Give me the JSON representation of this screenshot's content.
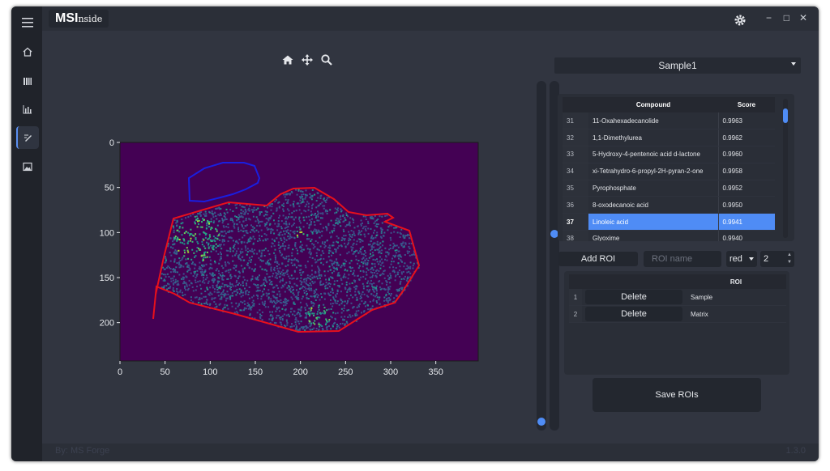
{
  "app": {
    "logo_main": "MSI",
    "logo_sub": "nside",
    "footer_left": "By: MS Forge",
    "footer_right": "1.3.0"
  },
  "window_controls": [
    "−",
    "□",
    "✕"
  ],
  "sidebar": {
    "items": [
      {
        "icon": "menu-icon"
      },
      {
        "icon": "home-icon"
      },
      {
        "icon": "library-icon"
      },
      {
        "icon": "bar-chart-icon"
      },
      {
        "icon": "draw-icon",
        "active": true
      },
      {
        "icon": "image-icon"
      }
    ]
  },
  "plot": {
    "toolbar": [
      "home-icon",
      "pan-icon",
      "zoom-icon"
    ],
    "x_ticks": [
      "0",
      "50",
      "100",
      "150",
      "200",
      "250",
      "300",
      "350"
    ],
    "y_ticks": [
      "0",
      "50",
      "100",
      "150",
      "200"
    ],
    "colormap": "viridis",
    "background_color": "#440154",
    "roi_colors": {
      "sample": "#e8101c",
      "matrix": "#1a1ee0"
    }
  },
  "sliders": {
    "left_level": 0.0,
    "right_level": 0.58
  },
  "sample_select": {
    "value": "Sample1"
  },
  "compound_table": {
    "headers": [
      "",
      "Compound",
      "Score"
    ],
    "rows": [
      {
        "index": "31",
        "compound": "11-Oxahexadecanolide",
        "score": "0.9963"
      },
      {
        "index": "32",
        "compound": "1,1-Dimethylurea",
        "score": "0.9962"
      },
      {
        "index": "33",
        "compound": "5-Hydroxy-4-pentenoic acid d-lactone",
        "score": "0.9960"
      },
      {
        "index": "34",
        "compound": "xi-Tetrahydro-6-propyl-2H-pyran-2-one",
        "score": "0.9958"
      },
      {
        "index": "35",
        "compound": "Pyrophosphate",
        "score": "0.9952"
      },
      {
        "index": "36",
        "compound": "8-oxodecanoic acid",
        "score": "0.9950"
      },
      {
        "index": "37",
        "compound": "Linoleic acid",
        "score": "0.9941",
        "selected": true
      },
      {
        "index": "38",
        "compound": "Glyoxime",
        "score": "0.9940"
      }
    ]
  },
  "roi_controls": {
    "add_label": "Add ROI",
    "name_placeholder": "ROI name",
    "color_value": "red",
    "width_value": "2"
  },
  "roi_table": {
    "header": "ROI",
    "rows": [
      {
        "index": "1",
        "action": "Delete",
        "name": "Sample"
      },
      {
        "index": "2",
        "action": "Delete",
        "name": "Matrix"
      }
    ]
  },
  "save_label": "Save ROIs"
}
